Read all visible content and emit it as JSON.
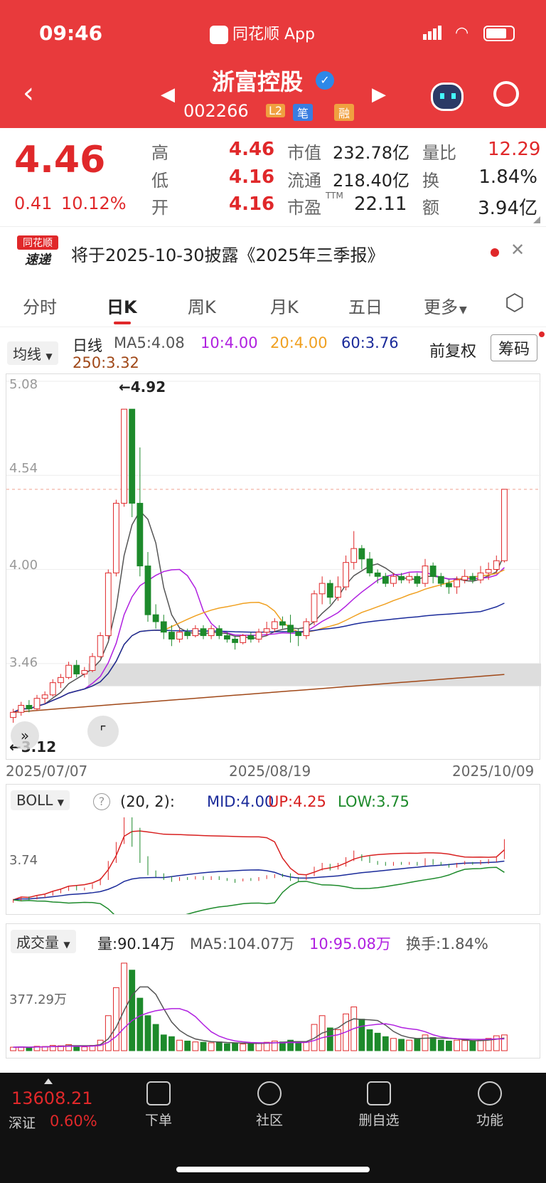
{
  "status_bar": {
    "time": "09:46",
    "app": "同花顺 App"
  },
  "header": {
    "stock_name": "浙富控股",
    "stock_code": "002266",
    "badges": [
      "L2",
      "笔",
      "融"
    ]
  },
  "quote": {
    "price": "4.46",
    "change": "0.41",
    "change_pct": "10.12%",
    "high_label": "高",
    "high": "4.46",
    "low_label": "低",
    "low": "4.16",
    "open_label": "开",
    "open": "4.16",
    "mcap_label": "市值",
    "mcap": "232.78亿",
    "float_label": "流通",
    "float": "218.40亿",
    "pe_label": "市盈",
    "pe_sup": "TTM",
    "pe": "22.11",
    "vr_label": "量比",
    "vr": "12.29",
    "turn_label": "换",
    "turn": "1.84%",
    "amt_label": "额",
    "amt": "3.94亿"
  },
  "news": {
    "logo_top": "同花顺",
    "logo_bottom": "速递",
    "text": "将于2025-10-30披露《2025年三季报》"
  },
  "tabs": [
    "分时",
    "日K",
    "周K",
    "月K",
    "五日",
    "更多"
  ],
  "active_tab": "日K",
  "kline": {
    "ma_selector": "均线",
    "period": "日线",
    "ma5": "MA5:4.08",
    "ma10": "10:4.00",
    "ma20": "20:4.00",
    "ma60": "60:3.76",
    "ma250": "250:3.32",
    "adjust": "前复权",
    "chips": "筹码",
    "y_ticks": [
      "5.08",
      "4.54",
      "4.00",
      "3.46"
    ],
    "max_note": "←4.92",
    "min_note": "←3.12",
    "x_ticks": [
      "2025/07/07",
      "2025/08/19",
      "2025/10/09"
    ]
  },
  "boll": {
    "label": "BOLL",
    "params": "(20, 2):",
    "mid": "MID:4.00",
    "up": "UP:4.25",
    "low": "LOW:3.75",
    "y_tick": "3.74"
  },
  "volume": {
    "label": "成交量",
    "vol": "量:90.14万",
    "ma5": "MA5:104.07万",
    "ma10": "10:95.08万",
    "turnover": "换手:1.84%",
    "y_tick": "377.29万"
  },
  "bottom": {
    "index_value": "13608.21",
    "index_name": "深证",
    "index_pct": "0.60%",
    "nav": [
      "下单",
      "社区",
      "删自选",
      "功能"
    ]
  },
  "chart_data": {
    "type": "candlestick",
    "title": "浙富控股 日K",
    "ylim": [
      3.12,
      5.08
    ],
    "x_ticks": [
      "2025/07/07",
      "2025/08/19",
      "2025/10/09"
    ],
    "candles": [
      [
        3.15,
        3.18,
        3.12,
        3.2
      ],
      [
        3.18,
        3.22,
        3.16,
        3.24
      ],
      [
        3.22,
        3.2,
        3.18,
        3.25
      ],
      [
        3.2,
        3.26,
        3.19,
        3.28
      ],
      [
        3.26,
        3.28,
        3.23,
        3.3
      ],
      [
        3.28,
        3.35,
        3.27,
        3.37
      ],
      [
        3.35,
        3.38,
        3.32,
        3.4
      ],
      [
        3.38,
        3.45,
        3.37,
        3.47
      ],
      [
        3.45,
        3.4,
        3.38,
        3.48
      ],
      [
        3.4,
        3.42,
        3.38,
        3.44
      ],
      [
        3.42,
        3.5,
        3.41,
        3.52
      ],
      [
        3.5,
        3.62,
        3.49,
        3.64
      ],
      [
        3.62,
        3.98,
        3.6,
        4.0
      ],
      [
        3.98,
        4.38,
        3.96,
        4.4
      ],
      [
        4.38,
        4.92,
        4.36,
        4.92
      ],
      [
        4.92,
        4.38,
        4.3,
        4.92
      ],
      [
        4.38,
        4.02,
        3.96,
        4.7
      ],
      [
        4.02,
        3.74,
        3.7,
        4.1
      ],
      [
        3.74,
        3.7,
        3.66,
        3.8
      ],
      [
        3.7,
        3.64,
        3.6,
        3.74
      ],
      [
        3.64,
        3.6,
        3.56,
        3.68
      ],
      [
        3.6,
        3.64,
        3.58,
        3.66
      ],
      [
        3.64,
        3.62,
        3.6,
        3.66
      ],
      [
        3.62,
        3.66,
        3.61,
        3.68
      ],
      [
        3.66,
        3.62,
        3.6,
        3.68
      ],
      [
        3.62,
        3.66,
        3.6,
        3.68
      ],
      [
        3.66,
        3.62,
        3.6,
        3.68
      ],
      [
        3.62,
        3.6,
        3.58,
        3.64
      ],
      [
        3.6,
        3.58,
        3.54,
        3.62
      ],
      [
        3.58,
        3.62,
        3.57,
        3.63
      ],
      [
        3.62,
        3.6,
        3.58,
        3.64
      ],
      [
        3.6,
        3.64,
        3.58,
        3.66
      ],
      [
        3.64,
        3.66,
        3.62,
        3.7
      ],
      [
        3.66,
        3.7,
        3.64,
        3.72
      ],
      [
        3.7,
        3.68,
        3.66,
        3.73
      ],
      [
        3.68,
        3.64,
        3.58,
        3.74
      ],
      [
        3.64,
        3.62,
        3.56,
        3.66
      ],
      [
        3.62,
        3.7,
        3.6,
        3.72
      ],
      [
        3.7,
        3.86,
        3.68,
        3.88
      ],
      [
        3.86,
        3.92,
        3.8,
        3.96
      ],
      [
        3.92,
        3.84,
        3.8,
        3.94
      ],
      [
        3.84,
        3.9,
        3.82,
        3.96
      ],
      [
        3.9,
        4.04,
        3.88,
        4.08
      ],
      [
        4.04,
        4.12,
        4.0,
        4.22
      ],
      [
        4.12,
        4.06,
        4.0,
        4.14
      ],
      [
        4.06,
        3.98,
        3.96,
        4.1
      ],
      [
        3.98,
        3.96,
        3.92,
        4.0
      ],
      [
        3.96,
        3.92,
        3.9,
        3.98
      ],
      [
        3.92,
        3.96,
        3.9,
        3.98
      ],
      [
        3.96,
        3.94,
        3.92,
        3.98
      ],
      [
        3.94,
        3.96,
        3.92,
        3.98
      ],
      [
        3.96,
        3.92,
        3.9,
        3.98
      ],
      [
        3.92,
        4.02,
        3.9,
        4.06
      ],
      [
        4.02,
        3.96,
        3.92,
        4.04
      ],
      [
        3.96,
        3.92,
        3.9,
        3.98
      ],
      [
        3.92,
        3.9,
        3.86,
        3.94
      ],
      [
        3.9,
        3.94,
        3.86,
        3.96
      ],
      [
        3.94,
        3.96,
        3.92,
        4.0
      ],
      [
        3.96,
        3.94,
        3.92,
        3.98
      ],
      [
        3.94,
        3.98,
        3.92,
        4.02
      ],
      [
        3.98,
        4.0,
        3.94,
        4.04
      ],
      [
        4.0,
        4.05,
        3.98,
        4.08
      ],
      [
        4.05,
        4.46,
        4.04,
        4.46
      ]
    ],
    "volumes": [
      20,
      22,
      18,
      25,
      24,
      30,
      28,
      35,
      26,
      22,
      30,
      60,
      200,
      360,
      500,
      460,
      300,
      200,
      150,
      90,
      80,
      60,
      55,
      50,
      48,
      45,
      50,
      40,
      42,
      38,
      40,
      45,
      48,
      55,
      50,
      60,
      45,
      50,
      150,
      200,
      130,
      120,
      210,
      250,
      180,
      120,
      100,
      80,
      70,
      65,
      60,
      70,
      90,
      75,
      60,
      55,
      60,
      58,
      55,
      60,
      70,
      85,
      90
    ],
    "boll_mid_note": "MID:4.00",
    "boll_up_note": "UP:4.25",
    "boll_low_note": "LOW:3.75"
  }
}
